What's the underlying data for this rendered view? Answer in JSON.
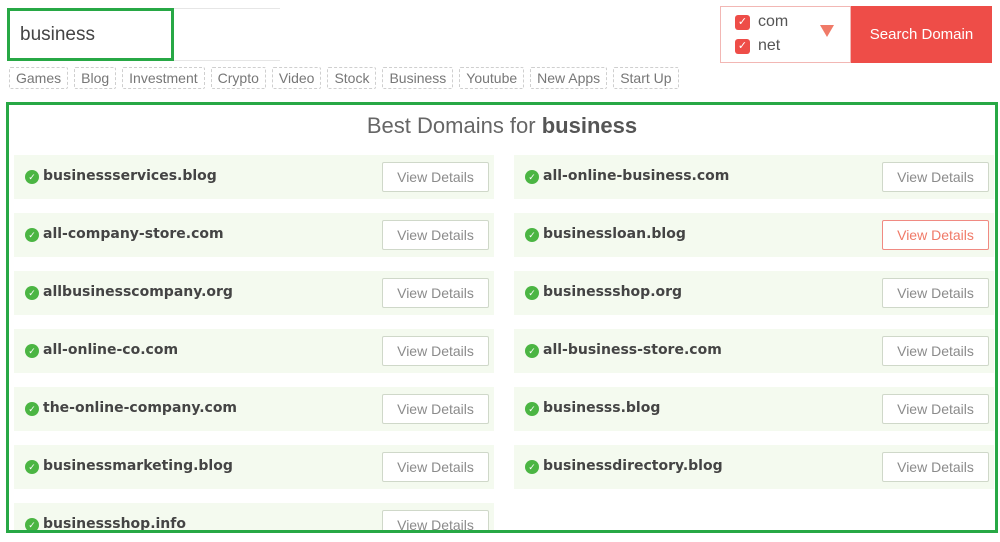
{
  "search": {
    "value": "business"
  },
  "extensions": [
    {
      "label": "com",
      "checked": true
    },
    {
      "label": "net",
      "checked": true
    }
  ],
  "search_button_label": "Search Domain",
  "tags": [
    "Games",
    "Blog",
    "Investment",
    "Crypto",
    "Video",
    "Stock",
    "Business",
    "Youtube",
    "New Apps",
    "Start Up"
  ],
  "results": {
    "title_prefix": "Best Domains for",
    "title_keyword": "business",
    "details_label": "View Details",
    "left": [
      "businessservices.blog",
      "all-company-store.com",
      "allbusinesscompany.org",
      "all-online-co.com",
      "the-online-company.com",
      "businessmarketing.blog",
      "businessshop.info"
    ],
    "right": [
      "all-online-business.com",
      "businessloan.blog",
      "businessshop.org",
      "all-business-store.com",
      "businesss.blog",
      "businessdirectory.blog"
    ]
  },
  "colors": {
    "accent": "#ee4d48",
    "highlight_border": "#27a845",
    "check": "#4bb543",
    "card_bg": "#f4faef"
  },
  "icons": {
    "checkbox": "check-mark",
    "dropdown": "triangle-down",
    "available": "check-circle"
  }
}
